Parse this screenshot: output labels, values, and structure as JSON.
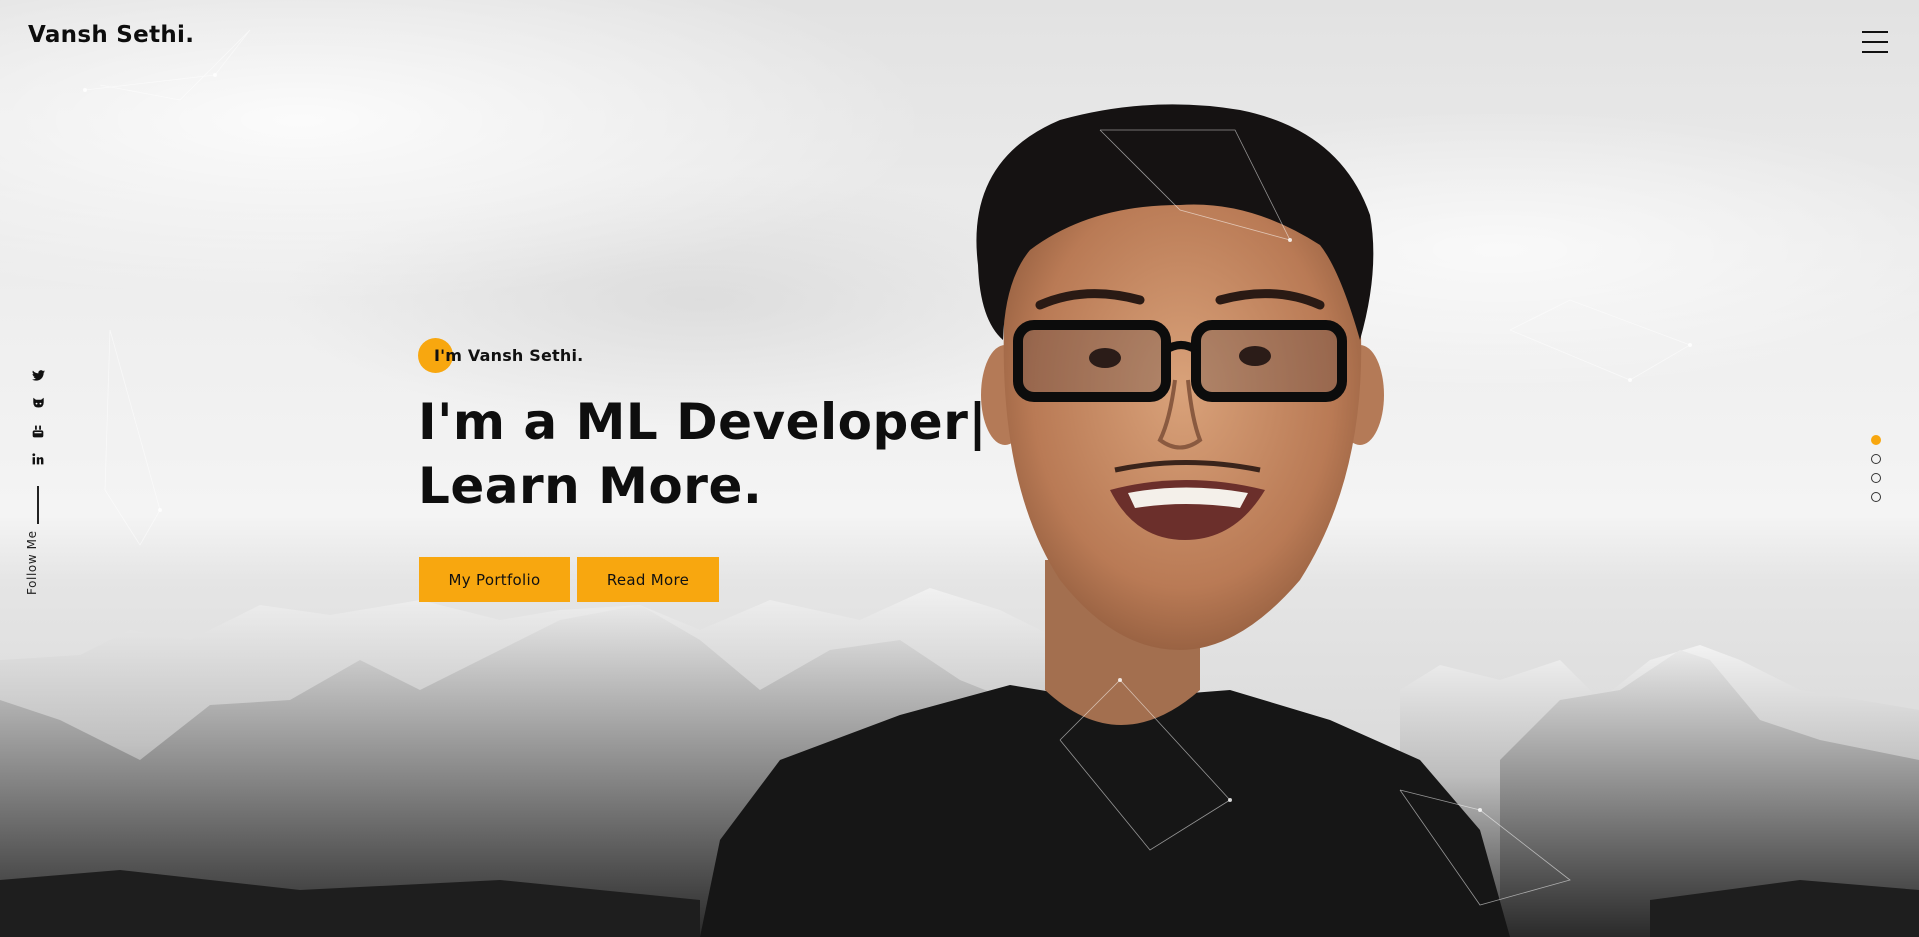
{
  "brand": {
    "logo_text": "Vansh Sethi."
  },
  "header": {
    "menu_icon": "hamburger-menu-icon"
  },
  "social": {
    "items": [
      {
        "name": "twitter",
        "icon": "twitter-icon"
      },
      {
        "name": "github",
        "icon": "github-icon"
      },
      {
        "name": "youtube",
        "icon": "youtube-icon"
      },
      {
        "name": "linkedin",
        "icon": "linkedin-icon"
      }
    ],
    "follow_label": "Follow Me"
  },
  "hero": {
    "intro": "I'm Vansh Sethi.",
    "headline_line1": "I'm a ML Developer|",
    "headline_line2": "Learn More.",
    "buttons": {
      "portfolio": "My Portfolio",
      "read_more": "Read More"
    }
  },
  "pager": {
    "count": 4,
    "active_index": 0
  },
  "colors": {
    "accent": "#f8a70f",
    "text": "#0e0e0e"
  }
}
